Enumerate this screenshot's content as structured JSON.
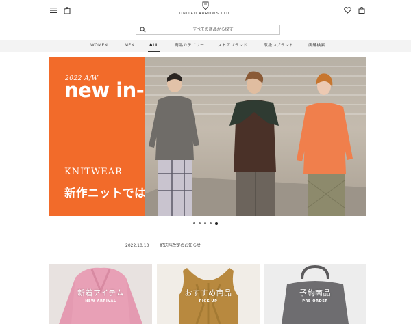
{
  "header": {
    "logo_text": "UNITED ARROWS LTD.",
    "menu_icon": "hamburger-icon",
    "store_icon": "shopping-bag-alt-icon",
    "favorite_icon": "heart-icon",
    "cart_icon": "shopping-bag-icon"
  },
  "search": {
    "placeholder": "すべての商品から探す",
    "icon": "search-icon"
  },
  "nav": {
    "items": [
      {
        "label": "WOMEN"
      },
      {
        "label": "MEN"
      },
      {
        "label": "ALL",
        "active": true
      },
      {
        "label": "商品カテゴリー"
      },
      {
        "label": "ストアブランド"
      },
      {
        "label": "取扱いブランド"
      },
      {
        "label": "店舗検索"
      }
    ]
  },
  "hero": {
    "season": "2022 A/W",
    "headline": "new in-",
    "subtitle": "KNITWEAR",
    "catch": "新作ニットではじめる秋",
    "accent": "#f26b2a"
  },
  "carousel": {
    "count": 5,
    "active_index": 4
  },
  "news": {
    "date": "2022.10.13",
    "title": "配送料改定のお知らせ"
  },
  "tiles": [
    {
      "jp": "新着アイテム",
      "en": "NEW ARRIVAL",
      "color": "#d9a7b3"
    },
    {
      "jp": "おすすめ商品",
      "en": "PICK UP",
      "color": "#d9cfc0"
    },
    {
      "jp": "予約商品",
      "en": "PRE ORDER",
      "color": "#e9e7e4"
    }
  ]
}
